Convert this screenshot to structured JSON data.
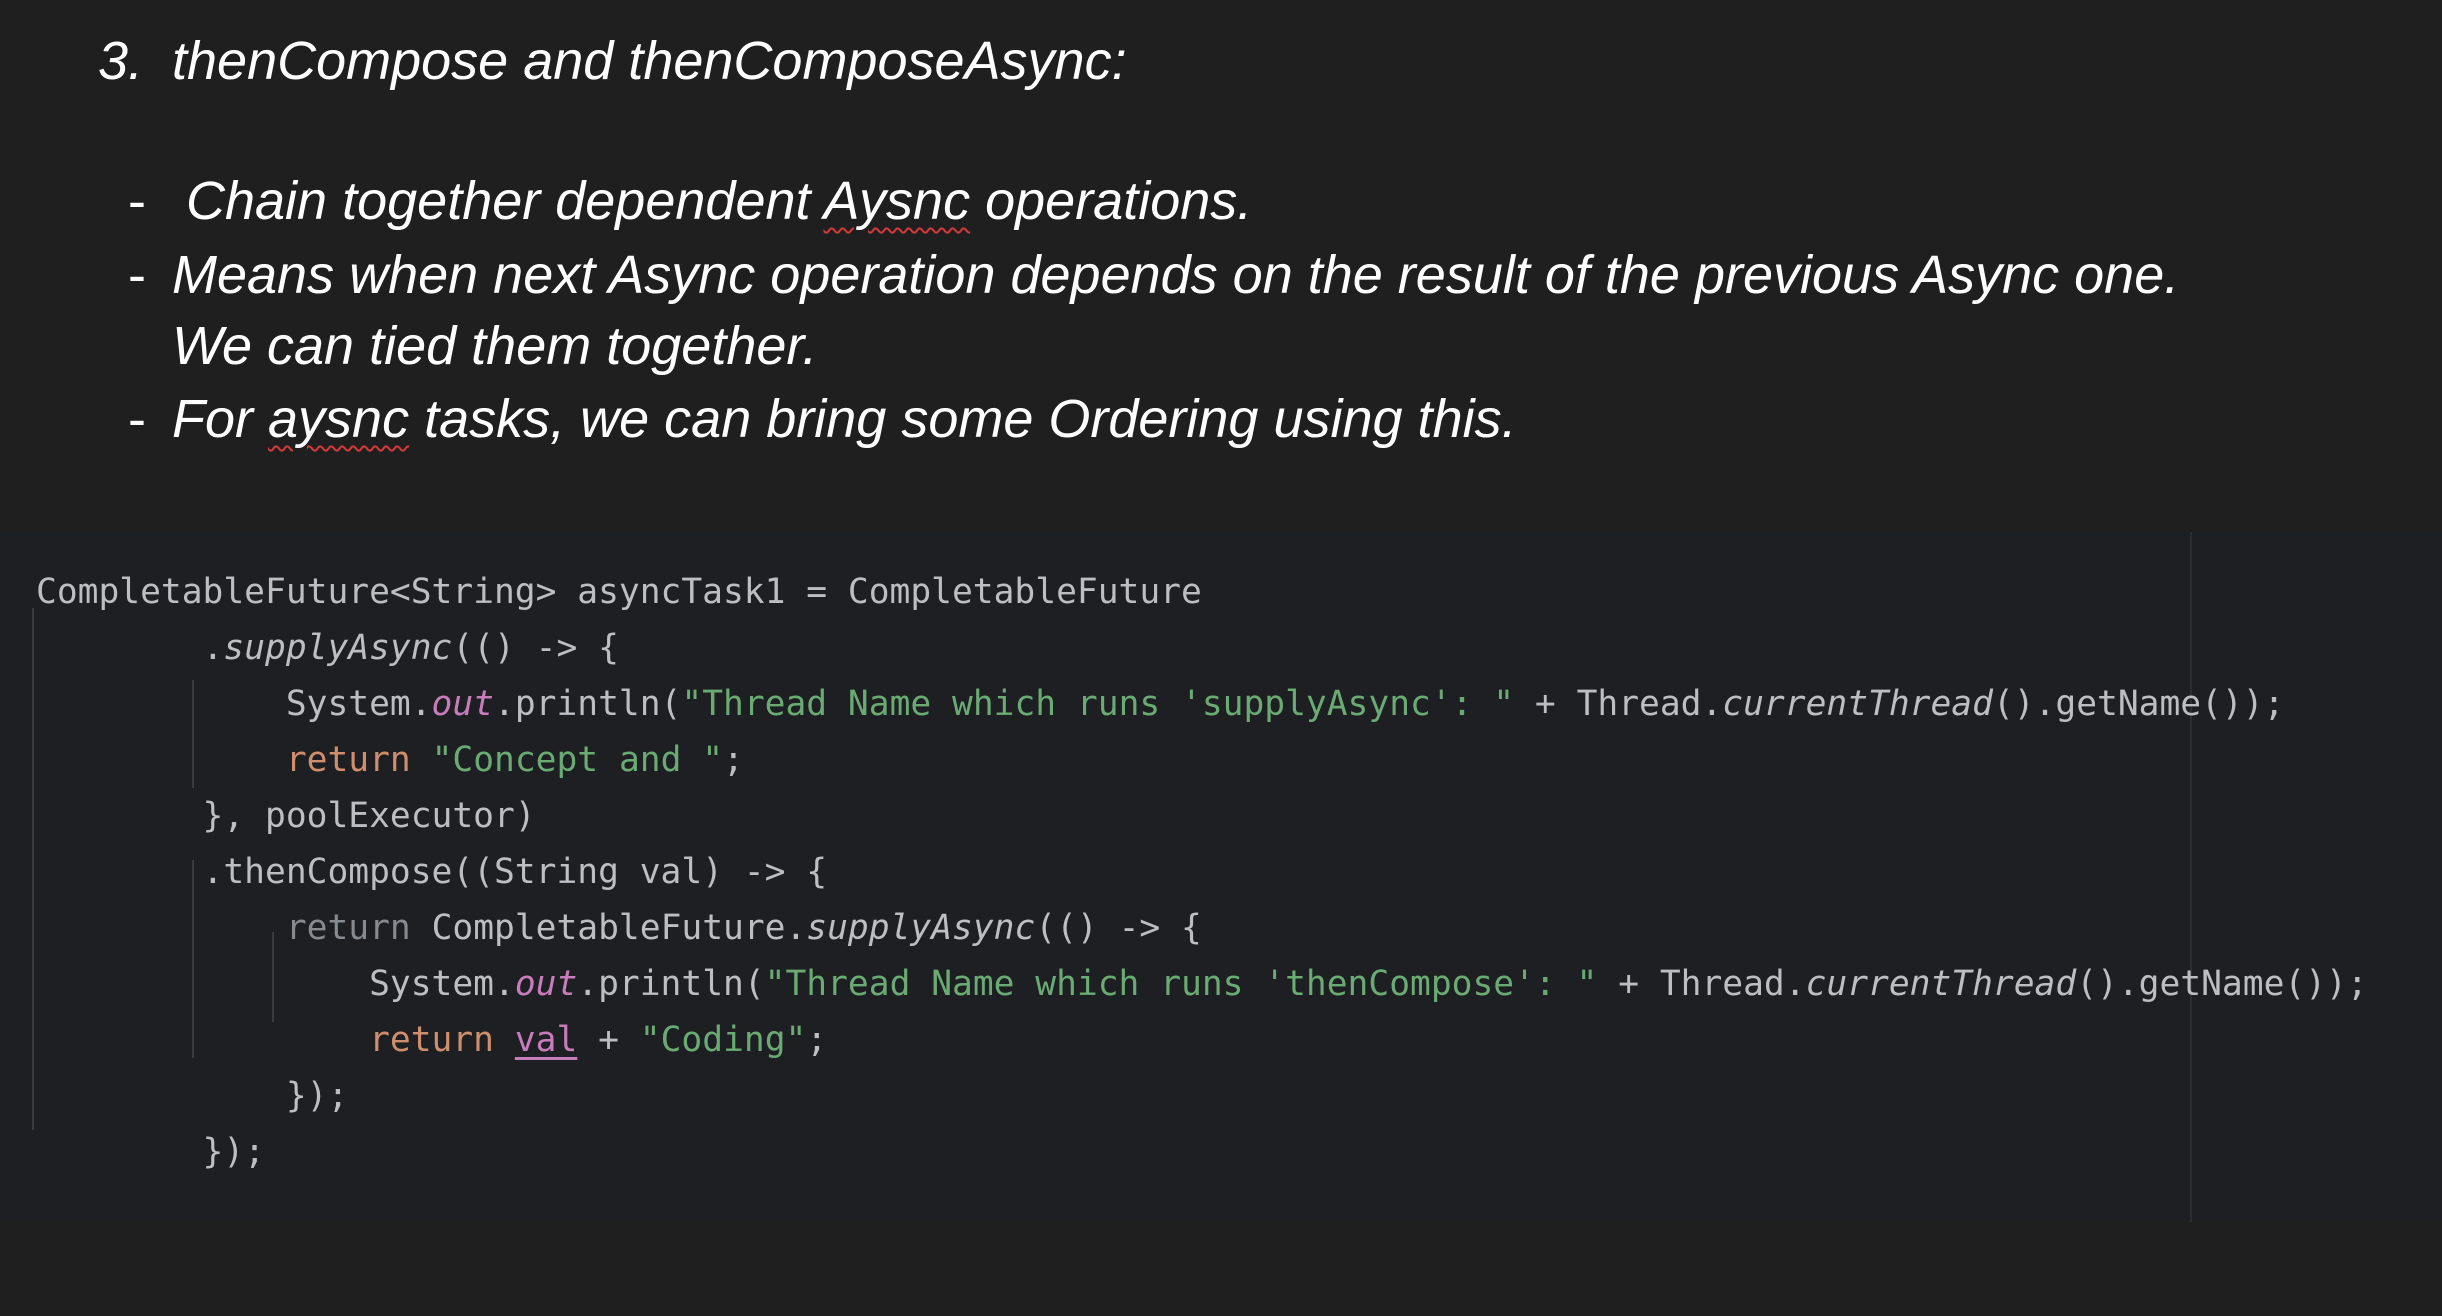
{
  "heading": {
    "number": "3.",
    "title": "thenCompose and thenComposeAsync:"
  },
  "bullets": [
    {
      "dash": "-",
      "lines": [
        [
          {
            "t": "Chain together dependent "
          },
          {
            "t": "Aysnc",
            "sq": true
          },
          {
            "t": " operations."
          }
        ]
      ]
    },
    {
      "dash": "-",
      "lines": [
        [
          {
            "t": "Means when next Async operation depends on the result of the previous Async one."
          }
        ],
        [
          {
            "t": "We can tied them together."
          }
        ]
      ]
    },
    {
      "dash": "-",
      "lines": [
        [
          {
            "t": "For "
          },
          {
            "t": "aysnc",
            "sq": true
          },
          {
            "t": " tasks, we can bring some Ordering using this."
          }
        ]
      ]
    }
  ],
  "code_lines": [
    [
      {
        "t": "CompletableFuture<String> asyncTask1 = CompletableFuture"
      }
    ],
    [
      {
        "t": "        ."
      },
      {
        "t": "supplyAsync",
        "c": "it"
      },
      {
        "t": "(() -> {"
      }
    ],
    [
      {
        "t": "            System."
      },
      {
        "t": "out",
        "c": "fld"
      },
      {
        "t": ".println("
      },
      {
        "t": "\"Thread Name which runs 'supplyAsync': \"",
        "c": "str"
      },
      {
        "t": " + Thread."
      },
      {
        "t": "currentThread",
        "c": "it"
      },
      {
        "t": "().getName());"
      }
    ],
    [
      {
        "t": "            "
      },
      {
        "t": "return",
        "c": "kw"
      },
      {
        "t": " "
      },
      {
        "t": "\"Concept and \"",
        "c": "str"
      },
      {
        "t": ";"
      }
    ],
    [
      {
        "t": "        }, poolExecutor)"
      }
    ],
    [
      {
        "t": "        .thenCompose((String val) -> {"
      }
    ],
    [
      {
        "t": "            "
      },
      {
        "t": "return",
        "c": "ret-dim"
      },
      {
        "t": " CompletableFuture."
      },
      {
        "t": "supplyAsync",
        "c": "it"
      },
      {
        "t": "(() -> {"
      }
    ],
    [
      {
        "t": "                System."
      },
      {
        "t": "out",
        "c": "fld"
      },
      {
        "t": ".println("
      },
      {
        "t": "\"Thread Name which runs 'thenCompose': \"",
        "c": "str"
      },
      {
        "t": " + Thread."
      },
      {
        "t": "currentThread",
        "c": "it"
      },
      {
        "t": "().getName());"
      }
    ],
    [
      {
        "t": "                "
      },
      {
        "t": "return",
        "c": "kw"
      },
      {
        "t": " "
      },
      {
        "t": "val",
        "c": "ulval"
      },
      {
        "t": " + "
      },
      {
        "t": "\"Coding\"",
        "c": "str"
      },
      {
        "t": ";"
      }
    ],
    [
      {
        "t": "            });"
      }
    ],
    [
      {
        "t": "        });"
      }
    ]
  ],
  "colors": {
    "background": "#1f1f1f",
    "code_background": "#1e1f22",
    "code_text": "#bcbec4",
    "keyword": "#cf8e6d",
    "string": "#6aab73",
    "field": "#c77dbb",
    "squiggle": "#d33a3a"
  }
}
